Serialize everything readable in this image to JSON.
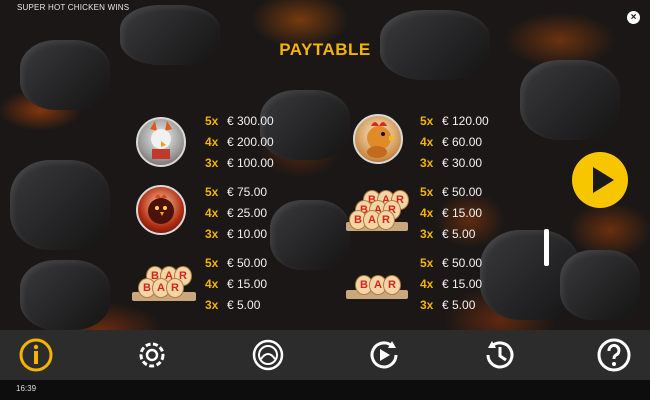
{
  "game_title": "SUPER HOT CHICKEN WINS",
  "close_label": "×",
  "heading": "PAYTABLE",
  "symbols": [
    {
      "name": "devil-chicken",
      "pays": [
        {
          "mult": "5x",
          "value": "€ 300.00"
        },
        {
          "mult": "4x",
          "value": "€ 200.00"
        },
        {
          "mult": "3x",
          "value": "€ 100.00"
        }
      ]
    },
    {
      "name": "rooster",
      "pays": [
        {
          "mult": "5x",
          "value": "€ 120.00"
        },
        {
          "mult": "4x",
          "value": "€ 60.00"
        },
        {
          "mult": "3x",
          "value": "€ 30.00"
        }
      ]
    },
    {
      "name": "dark-chicken",
      "pays": [
        {
          "mult": "5x",
          "value": "€ 75.00"
        },
        {
          "mult": "4x",
          "value": "€ 25.00"
        },
        {
          "mult": "3x",
          "value": "€ 10.00"
        }
      ]
    },
    {
      "name": "triple-bar",
      "pays": [
        {
          "mult": "5x",
          "value": "€ 50.00"
        },
        {
          "mult": "4x",
          "value": "€ 15.00"
        },
        {
          "mult": "3x",
          "value": "€ 5.00"
        }
      ]
    },
    {
      "name": "double-bar",
      "pays": [
        {
          "mult": "5x",
          "value": "€ 50.00"
        },
        {
          "mult": "4x",
          "value": "€ 15.00"
        },
        {
          "mult": "3x",
          "value": "€ 5.00"
        }
      ]
    },
    {
      "name": "single-bar",
      "pays": [
        {
          "mult": "5x",
          "value": "€ 50.00"
        },
        {
          "mult": "4x",
          "value": "€ 15.00"
        },
        {
          "mult": "3x",
          "value": "€ 5.00"
        }
      ]
    }
  ],
  "bar_letters": {
    "b": "B",
    "a": "A",
    "r": "R"
  },
  "toolbar": [
    {
      "name": "info-icon",
      "active": true
    },
    {
      "name": "settings-icon",
      "active": false
    },
    {
      "name": "bet-icon",
      "active": false
    },
    {
      "name": "autoplay-icon",
      "active": false
    },
    {
      "name": "history-icon",
      "active": false
    },
    {
      "name": "help-icon",
      "active": false
    }
  ],
  "clock": "16:39",
  "colors": {
    "accent": "#f5b400",
    "play": "#f7c600",
    "toolbar_bg": "#2c2c2c"
  }
}
